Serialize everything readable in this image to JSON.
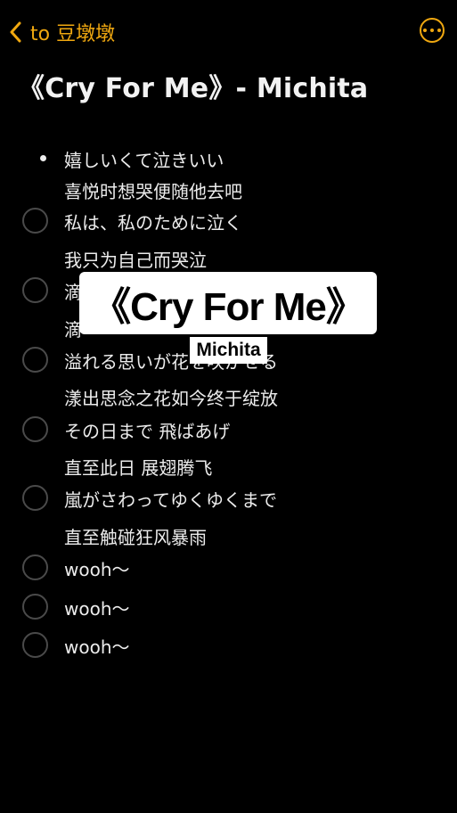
{
  "header": {
    "back_label": "to 豆墩墩",
    "back_icon": "chevron-left",
    "more_icon": "ellipsis-circle",
    "accent": "#f0a810"
  },
  "note_title": "《Cry For Me》- Michita",
  "overlay": {
    "title": "《Cry For Me》",
    "artist": "Michita"
  },
  "items": [
    {
      "text": "嬉しいくて泣きいい",
      "translation": "喜悦时想哭便随他去吧",
      "marker": "bullet"
    },
    {
      "text": "私は、私のために泣く",
      "translation": "我只为自己而哭泣",
      "marker": "circle"
    },
    {
      "text": "滴",
      "translation": "滴",
      "marker": "circle"
    },
    {
      "text": "溢れる思いが花を咲かせる",
      "translation": "漾出思念之花如今终于绽放",
      "marker": "circle"
    },
    {
      "text": "その日まで 飛ばあげ",
      "translation": "直至此日 展翅腾飞",
      "marker": "circle"
    },
    {
      "text": "嵐がさわってゆくゆくまで",
      "translation": "直至触碰狂风暴雨",
      "marker": "circle"
    },
    {
      "text": "wooh～",
      "translation": "",
      "marker": "circle"
    },
    {
      "text": "wooh～",
      "translation": "",
      "marker": "circle"
    },
    {
      "text": "wooh～",
      "translation": "",
      "marker": "circle"
    }
  ]
}
